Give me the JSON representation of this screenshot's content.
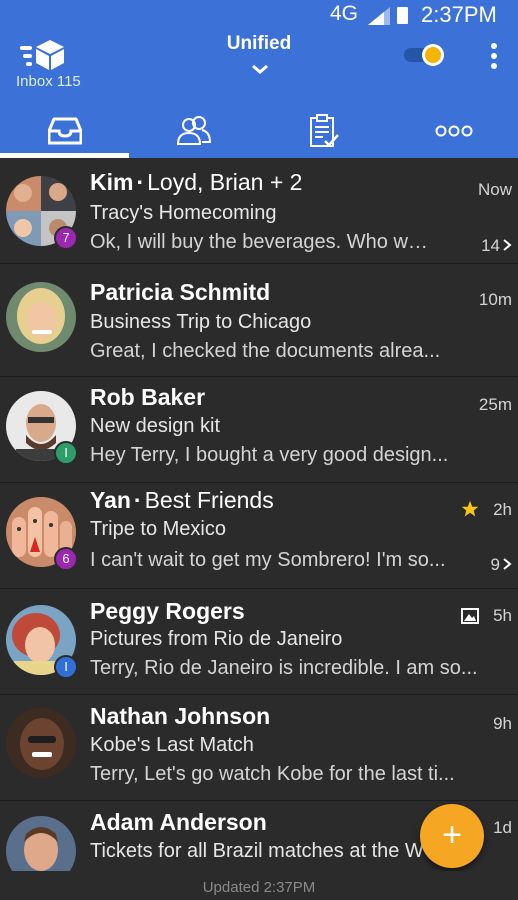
{
  "status_bar": {
    "network": "4G",
    "time": "2:37PM"
  },
  "header": {
    "inbox_label": "Inbox 115",
    "title": "Unified"
  },
  "tabs": [
    {
      "name": "inbox"
    },
    {
      "name": "contacts"
    },
    {
      "name": "tasks"
    },
    {
      "name": "more"
    }
  ],
  "messages": [
    {
      "name": "Kim",
      "group": "Loyd, Brian + 2",
      "subject": "Tracy's Homecoming",
      "preview": "Ok, I will buy the beverages. Who will..",
      "time": "Now",
      "thread_count": "14",
      "badge": "7"
    },
    {
      "name": "Patricia Schmitd",
      "subject": "Business Trip to Chicago",
      "preview": "Great, I checked the documents alrea...",
      "time": "10m"
    },
    {
      "name": "Rob Baker",
      "subject": "New design kit",
      "preview": "Hey Terry, I bought a very good design...",
      "time": "25m",
      "badge": "I"
    },
    {
      "name": "Yan",
      "group": "Best Friends",
      "subject": "Tripe to Mexico",
      "preview": "I can't wait to get my Sombrero! I'm so...",
      "time": "2h",
      "thread_count": "9",
      "badge": "6",
      "starred": true
    },
    {
      "name": "Peggy Rogers",
      "subject": "Pictures from Rio de Janeiro",
      "preview": "Terry, Rio de Janeiro is incredible. I am so...",
      "time": "5h",
      "badge": "I",
      "has_image": true
    },
    {
      "name": "Nathan Johnson",
      "subject": "Kobe's Last Match",
      "preview": "Terry, Let's go watch Kobe for the last ti...",
      "time": "9h"
    },
    {
      "name": "Adam Anderson",
      "subject": "Tickets for all Brazil matches at the W",
      "preview": "",
      "time": "1d"
    }
  ],
  "fab": {
    "label": "+"
  },
  "footer": {
    "updated": "Updated 2:37PM"
  },
  "colors": {
    "header": "#3c72d8",
    "background": "#2b2b2b",
    "fab": "#f5a623",
    "badge_purple": "#9c27b0",
    "badge_green": "#2e9d6b",
    "badge_blue": "#2f6fd6",
    "star": "#f5c518"
  },
  "icons": [
    "inbox-tray-icon",
    "contacts-icon",
    "tasks-clipboard-icon",
    "more-dots-icon",
    "overflow-menu-icon",
    "chevron-down-icon",
    "star-icon",
    "image-icon",
    "chevron-right-icon"
  ]
}
